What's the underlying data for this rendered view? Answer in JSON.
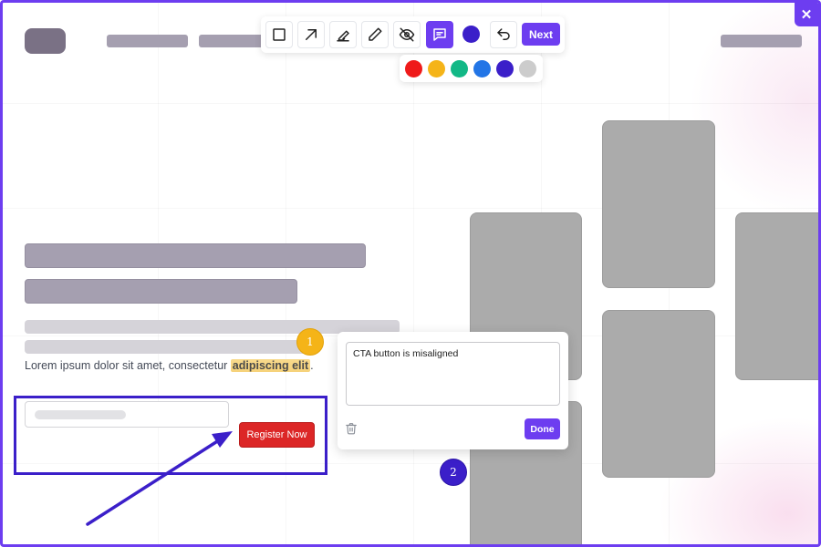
{
  "window": {
    "close_glyph": "✕"
  },
  "toolbar": {
    "tools": [
      {
        "name": "rectangle-tool",
        "icon": "square-icon"
      },
      {
        "name": "arrow-tool",
        "icon": "arrow-up-right-icon"
      },
      {
        "name": "highlighter-tool",
        "icon": "highlighter-icon"
      },
      {
        "name": "pen-tool",
        "icon": "pencil-icon"
      },
      {
        "name": "hide-tool",
        "icon": "eye-off-icon"
      },
      {
        "name": "comment-tool",
        "icon": "message-square-icon",
        "active": true
      }
    ],
    "current_color": "#3b1fc9",
    "undo_icon": "undo-icon",
    "next_label": "Next"
  },
  "palette": {
    "colors": [
      "#ef1a1a",
      "#f5b418",
      "#12b886",
      "#2275e6",
      "#3b1fc9",
      "#cccccc"
    ]
  },
  "page": {
    "lorem_before": "Lorem ipsum dolor sit amet, consectetur ",
    "lorem_highlight": "adipiscing elit",
    "lorem_after": ".",
    "cta_label": "Register Now"
  },
  "markers": {
    "first": "1",
    "second": "2"
  },
  "comment": {
    "text": "CTA button is misaligned",
    "delete_icon": "trash-icon",
    "done_label": "Done"
  },
  "colors": {
    "accent": "#6d3df0",
    "annotation_blue": "#3b1fc9",
    "cta_red": "#dc2626",
    "marker_yellow": "#f5b418"
  }
}
